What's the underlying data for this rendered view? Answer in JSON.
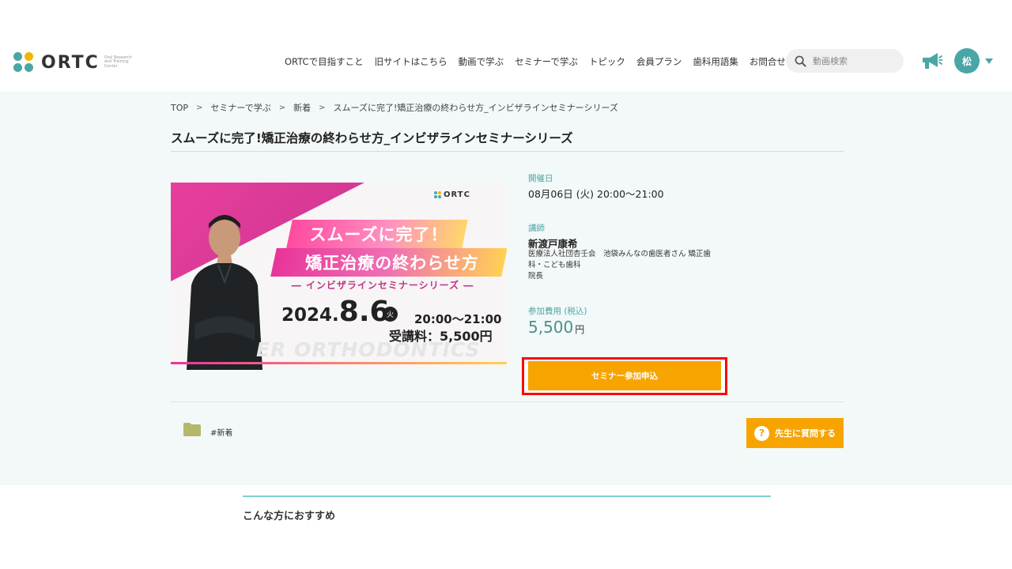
{
  "header": {
    "logo_text": "ORTC",
    "logo_subtext": "Oral Research and Training Center",
    "nav": [
      {
        "label": "ORTCで目指すこと"
      },
      {
        "label": "旧サイトはこちら"
      },
      {
        "label": "動画で学ぶ"
      },
      {
        "label": "セミナーで学ぶ"
      },
      {
        "label": "トピック"
      },
      {
        "label": "会員プラン"
      },
      {
        "label": "歯科用語集"
      },
      {
        "label": "お問合せ"
      }
    ],
    "search_placeholder": "動画検索",
    "avatar_initial": "松"
  },
  "breadcrumb": {
    "items": [
      "TOP",
      "セミナーで学ぶ",
      "新着",
      "スムーズに完了!矯正治療の終わらせ方_インビザラインセミナーシリーズ"
    ],
    "separator": ">"
  },
  "page_title": "スムーズに完了!矯正治療の終わらせ方_インビザラインセミナーシリーズ",
  "banner": {
    "logo_text": "ORTC",
    "headline1": "スムーズに完了！",
    "headline2": "矯正治療の終わらせ方",
    "series": "― インビザラインセミナーシリーズ ―",
    "date_year": "2024.",
    "date_md": "8.6",
    "day_of_week": "火",
    "time": "20:00〜21:00",
    "fee": "受講料：5,500円",
    "watermark": "ER ORTHODONTICS"
  },
  "details": {
    "date_label": "開催日",
    "date_value": "08月06日 (火) 20:00〜21:00",
    "instructor_label": "講師",
    "instructor_name": "新渡戸康希",
    "instructor_desc": "医療法人社団杏壬会　池袋みんなの歯医者さん 矯正歯科・こども歯科\n院長",
    "fee_label": "参加費用 (税込)",
    "fee_value": "5,500",
    "fee_unit": "円",
    "apply_label": "セミナー参加申込"
  },
  "tag": "#新着",
  "ask_label": "先生に質問する",
  "recommend_title": "こんな方におすすめ",
  "colors": {
    "accent_teal": "#4aa6a6",
    "accent_orange": "#f7a400",
    "highlight_red": "#ff0000",
    "banner_pink": "#e8349a"
  }
}
